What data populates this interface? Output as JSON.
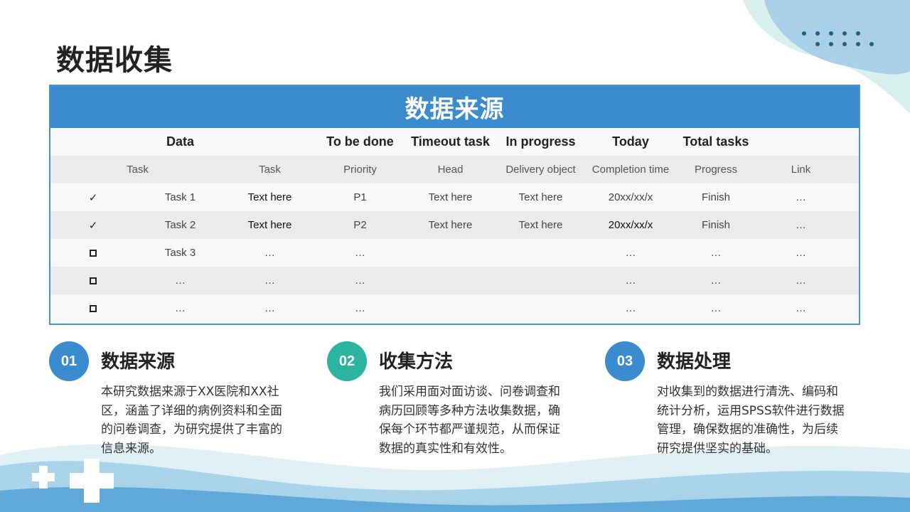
{
  "page": {
    "title": "数据收集"
  },
  "table": {
    "header": "数据来源",
    "columns_row1": [
      "",
      "Data",
      "",
      "To be done",
      "Timeout task",
      "In progress",
      "Today",
      "Total tasks",
      ""
    ],
    "columns_row2": [
      "Task",
      "",
      "Task",
      "Priority",
      "Head",
      "Delivery object",
      "Completion time",
      "Progress",
      "Link"
    ],
    "rows": [
      {
        "status": "check",
        "cells": [
          "Task 1",
          "Text here",
          "P1",
          "Text here",
          "Text here",
          "20xx/xx/x",
          "Finish",
          "…"
        ]
      },
      {
        "status": "check",
        "cells": [
          "Task 2",
          "Text here",
          "P2",
          "Text here",
          "Text here",
          "20xx/xx/x",
          "Finish",
          "…"
        ]
      },
      {
        "status": "box",
        "cells": [
          "Task 3",
          "…",
          "…",
          "",
          "",
          "…",
          "…",
          "…"
        ]
      },
      {
        "status": "box",
        "cells": [
          "…",
          "…",
          "…",
          "",
          "",
          "…",
          "…",
          "…"
        ]
      },
      {
        "status": "box",
        "cells": [
          "…",
          "…",
          "…",
          "",
          "",
          "…",
          "…",
          "…"
        ]
      }
    ],
    "check_glyph": "✓"
  },
  "sections": [
    {
      "number": "01",
      "title": "数据来源",
      "body": "本研究数据来源于XX医院和XX社区，涵盖了详细的病例资料和全面的问卷调查，为研究提供了丰富的信息来源。",
      "color": "#3a8ccf"
    },
    {
      "number": "02",
      "title": "收集方法",
      "body": "我们采用面对面访谈、问卷调查和病历回顾等多种方法收集数据，确保每个环节都严谨规范，从而保证数据的真实性和有效性。",
      "color": "#2bb5a0"
    },
    {
      "number": "03",
      "title": "数据处理",
      "body": "对收集到的数据进行清洗、编码和统计分析，运用SPSS软件进行数据管理，确保数据的准确性，为后续研究提供坚实的基础。",
      "color": "#3a8ccf"
    }
  ],
  "colors": {
    "accent_blue": "#3a8ccf",
    "accent_teal": "#2bb5a0",
    "wave_light": "#cfe6f3",
    "wave_mid": "#8fc3e3"
  }
}
